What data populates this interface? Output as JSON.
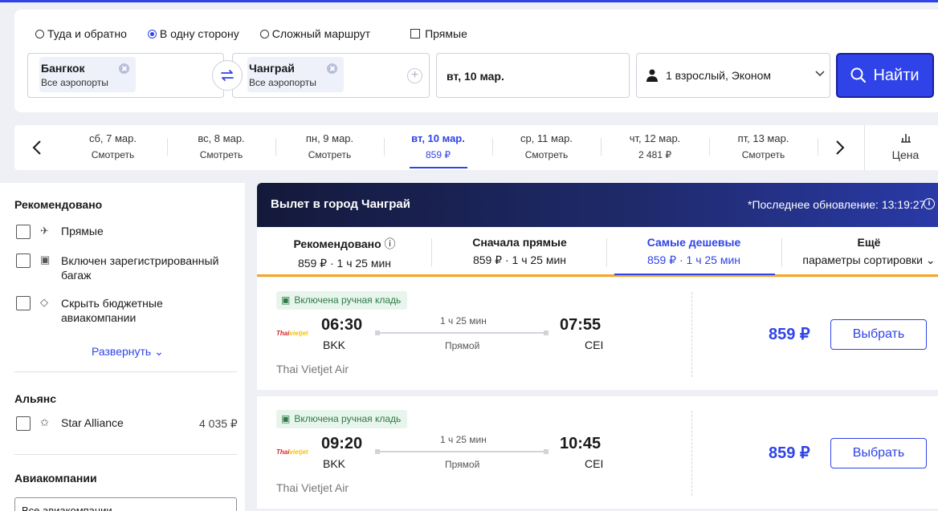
{
  "search": {
    "trip_types": [
      "Туда и обратно",
      "В одну сторону",
      "Сложный маршрут"
    ],
    "trip_selected": 1,
    "direct_label": "Прямые",
    "origin": {
      "city": "Бангкок",
      "sub": "Все аэропорты"
    },
    "destination": {
      "city": "Чанграй",
      "sub": "Все аэропорты"
    },
    "date": "вт, 10 мар.",
    "passengers": "1 взрослый, Эконом",
    "find_label": "Найти"
  },
  "datestrip": {
    "days": [
      {
        "date": "сб, 7 мар.",
        "price": "Смотреть"
      },
      {
        "date": "вс, 8 мар.",
        "price": "Смотреть"
      },
      {
        "date": "пн, 9 мар.",
        "price": "Смотреть"
      },
      {
        "date": "вт, 10 мар.",
        "price": "859 ₽"
      },
      {
        "date": "ср, 11 мар.",
        "price": "Смотреть"
      },
      {
        "date": "чт, 12 мар.",
        "price": "2 481 ₽"
      },
      {
        "date": "пт, 13 мар.",
        "price": "Смотреть"
      }
    ],
    "active_index": 3,
    "price_label": "Цена"
  },
  "filters": {
    "recommended_title": "Рекомендовано",
    "recommended": [
      "Прямые",
      "Включен зарегистрированный багаж",
      "Скрыть бюджетные авиакомпании"
    ],
    "expand_label": "Развернуть",
    "alliance_title": "Альянс",
    "alliance": {
      "name": "Star Alliance",
      "price": "4 035 ₽"
    },
    "airlines_title": "Авиакомпании",
    "airlines_select": "Все авиакомпании"
  },
  "results": {
    "banner_title": "Вылет в город Чанграй",
    "updated": "*Последнее обновление: 13:19:27",
    "sort_tabs": [
      {
        "title": "Рекомендовано",
        "sub": "859 ₽ · 1 ч 25 мин"
      },
      {
        "title": "Сначала прямые",
        "sub": "859 ₽ · 1 ч 25 мин"
      },
      {
        "title": "Самые дешевые",
        "sub": "859 ₽ · 1 ч 25 мин"
      },
      {
        "title": "Ещё",
        "sub": "параметры сортировки"
      }
    ],
    "active_sort": 2,
    "flights": [
      {
        "badge": "Включена ручная кладь",
        "dep_time": "06:30",
        "dep_code": "BKK",
        "arr_time": "07:55",
        "arr_code": "CEI",
        "duration": "1 ч 25 мин",
        "stops": "Прямой",
        "airline": "Thai Vietjet Air",
        "price": "859 ₽",
        "select": "Выбрать"
      },
      {
        "badge": "Включена ручная кладь",
        "dep_time": "09:20",
        "dep_code": "BKK",
        "arr_time": "10:45",
        "arr_code": "CEI",
        "duration": "1 ч 25 мин",
        "stops": "Прямой",
        "airline": "Thai Vietjet Air",
        "price": "859 ₽",
        "select": "Выбрать"
      }
    ]
  },
  "colors": {
    "accent": "#2f43e8",
    "banner": "#1f2a6b",
    "badge_bg": "#e8f5ec",
    "sort_underline": "#f5a623"
  }
}
